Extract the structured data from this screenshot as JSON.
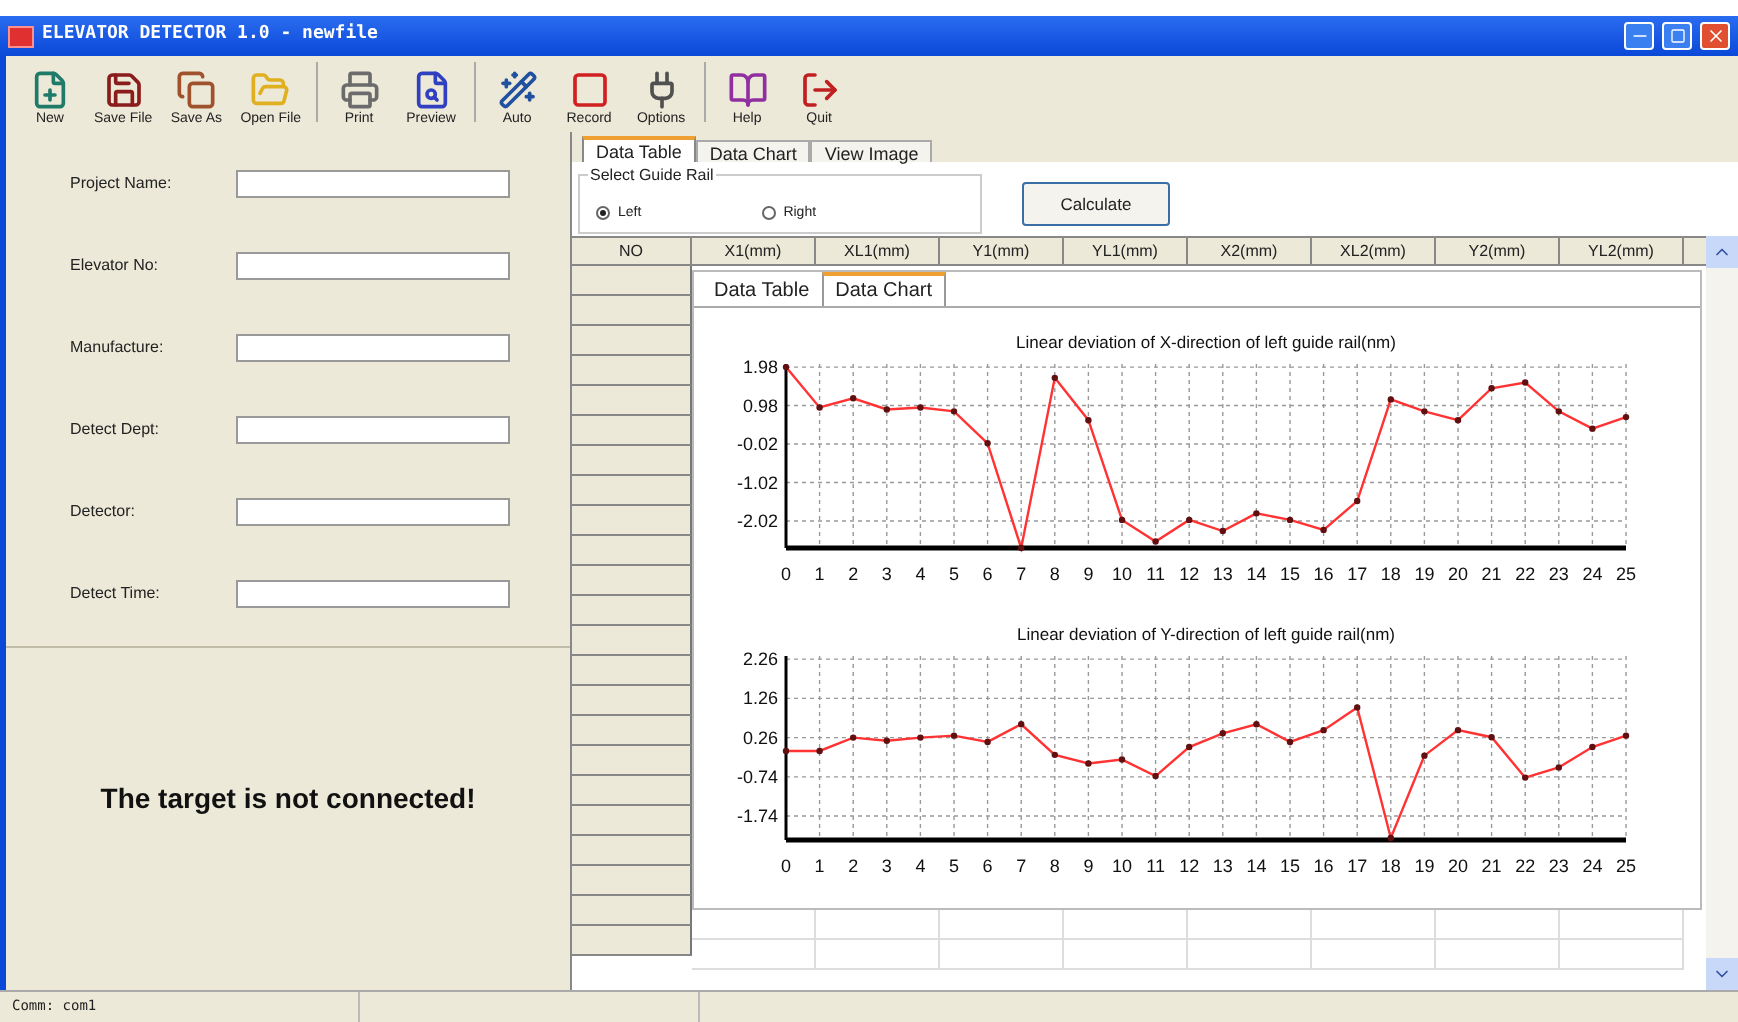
{
  "window": {
    "title": "ELEVATOR DETECTOR 1.0 - newfile"
  },
  "toolbar": [
    {
      "kind": "new",
      "label": "New"
    },
    {
      "kind": "save",
      "label": "Save File"
    },
    {
      "kind": "saveas",
      "label": "Save As"
    },
    {
      "kind": "open",
      "label": "Open File"
    },
    {
      "kind": "print",
      "label": "Print"
    },
    {
      "kind": "preview",
      "label": "Preview"
    },
    {
      "kind": "auto",
      "label": "Auto"
    },
    {
      "kind": "record",
      "label": "Record"
    },
    {
      "kind": "options",
      "label": "Options"
    },
    {
      "kind": "help",
      "label": "Help"
    },
    {
      "kind": "quit",
      "label": "Quit"
    }
  ],
  "form": [
    {
      "label": "Project Name:"
    },
    {
      "label": "Elevator No:"
    },
    {
      "label": "Manufacture:"
    },
    {
      "label": "Detect Dept:"
    },
    {
      "label": "Detector:"
    },
    {
      "label": "Detect Time:"
    }
  ],
  "connection_message": "The target is not connected!",
  "tabs": [
    {
      "label": "Data Table",
      "selected": true
    },
    {
      "label": "Data Chart",
      "selected": false
    },
    {
      "label": "View Image",
      "selected": false
    }
  ],
  "guide_rail": {
    "title": "Select Guide Rail",
    "options": [
      {
        "label": "Left",
        "selected": true
      },
      {
        "label": "Right",
        "selected": false
      }
    ]
  },
  "calculate_button": "Calculate",
  "table": {
    "columns": [
      "NO",
      "X1(mm)",
      "XL1(mm)",
      "Y1(mm)",
      "YL1(mm)",
      "X2(mm)",
      "XL2(mm)",
      "Y2(mm)",
      "YL2(mm)"
    ]
  },
  "inner_tabs": [
    {
      "label": "Data Table",
      "selected": false
    },
    {
      "label": "Data Chart",
      "selected": true
    }
  ],
  "charts": [
    {
      "chart_data": {
        "type": "line",
        "title": "Linear deviation of X-direction of left guide rail(nm)",
        "xlim": [
          0,
          25
        ],
        "grid": true,
        "x": [
          0,
          1,
          2,
          3,
          4,
          5,
          6,
          7,
          8,
          9,
          10,
          11,
          12,
          13,
          14,
          15,
          16,
          17,
          18,
          19,
          20,
          21,
          22,
          23,
          24,
          25
        ],
        "xticks": [
          0,
          1,
          2,
          3,
          4,
          5,
          6,
          7,
          8,
          9,
          10,
          11,
          12,
          13,
          14,
          15,
          16,
          17,
          18,
          19,
          20,
          21,
          22,
          23,
          24,
          25
        ],
        "ylim": [
          -2.72,
          2.06
        ],
        "yticks": [
          {
            "value": 1.98,
            "label": "1.98"
          },
          {
            "value": 0.98,
            "label": "0.98"
          },
          {
            "value": -0.02,
            "label": "-0.02"
          },
          {
            "value": -1.02,
            "label": "-1.02"
          },
          {
            "value": -2.02,
            "label": "-2.02"
          }
        ],
        "series": [
          {
            "color": "#ff3333",
            "marker": true,
            "values": [
              1.98,
              0.93,
              1.17,
              0.88,
              0.93,
              0.83,
              0.0,
              -2.72,
              1.7,
              0.6,
              -1.99,
              -2.55,
              -1.99,
              -2.28,
              -1.82,
              -1.99,
              -2.25,
              -1.5,
              1.14,
              0.83,
              0.6,
              1.43,
              1.58,
              0.83,
              0.38,
              0.68
            ]
          }
        ]
      }
    },
    {
      "chart_data": {
        "type": "line",
        "title": "Linear deviation of Y-direction of left guide rail(nm)",
        "xlim": [
          0,
          25
        ],
        "grid": true,
        "x": [
          0,
          1,
          2,
          3,
          4,
          5,
          6,
          7,
          8,
          9,
          10,
          11,
          12,
          13,
          14,
          15,
          16,
          17,
          18,
          19,
          20,
          21,
          22,
          23,
          24,
          25
        ],
        "xticks": [
          0,
          1,
          2,
          3,
          4,
          5,
          6,
          7,
          8,
          9,
          10,
          11,
          12,
          13,
          14,
          15,
          16,
          17,
          18,
          19,
          20,
          21,
          22,
          23,
          24,
          25
        ],
        "ylim": [
          -2.35,
          2.34
        ],
        "yticks": [
          {
            "value": 2.26,
            "label": "2.26"
          },
          {
            "value": 1.26,
            "label": "1.26"
          },
          {
            "value": 0.26,
            "label": "0.26"
          },
          {
            "value": -0.74,
            "label": "-0.74"
          },
          {
            "value": -1.74,
            "label": "-1.74"
          }
        ],
        "series": [
          {
            "color": "#ff3333",
            "marker": true,
            "values": [
              -0.08,
              -0.08,
              0.26,
              0.18,
              0.26,
              0.31,
              0.15,
              0.6,
              -0.18,
              -0.4,
              -0.3,
              -0.72,
              0.02,
              0.37,
              0.6,
              0.15,
              0.45,
              1.03,
              -2.3,
              -0.2,
              0.45,
              0.27,
              -0.76,
              -0.5,
              0.02,
              0.31
            ]
          }
        ]
      }
    }
  ],
  "status_bar": [
    "Comm: com1"
  ]
}
